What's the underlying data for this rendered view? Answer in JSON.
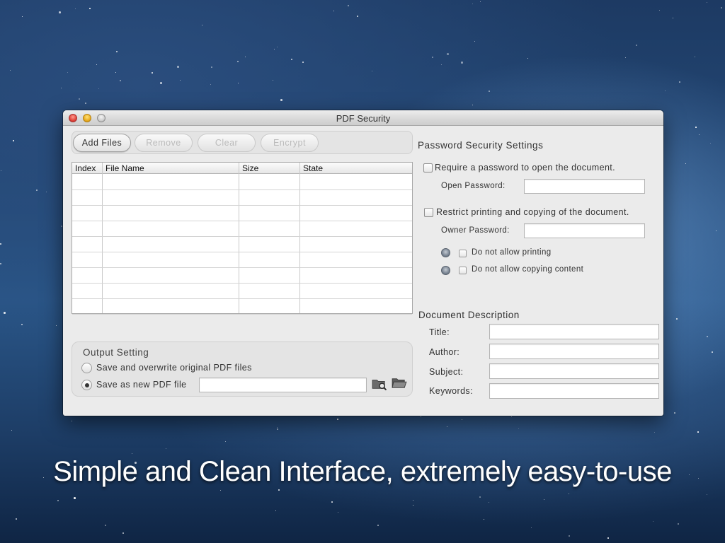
{
  "window": {
    "title": "PDF Security"
  },
  "toolbar": {
    "add_files": "Add Files",
    "remove": "Remove",
    "clear": "Clear",
    "encrypt": "Encrypt"
  },
  "table": {
    "columns": [
      "Index",
      "File Name",
      "Size",
      "State"
    ],
    "rows": []
  },
  "output": {
    "title": "Output Setting",
    "option_overwrite": "Save and overwrite original PDF files",
    "option_new": "Save as new PDF file",
    "selected": "new",
    "new_file_path": ""
  },
  "password": {
    "title": "Password Security Settings",
    "require_open": "Require a password to open the document.",
    "open_password_label": "Open Password:",
    "restrict": "Restrict printing and copying of the document.",
    "owner_password_label": "Owner Password:",
    "no_printing": "Do not allow printing",
    "no_copying": "Do not allow copying content"
  },
  "description": {
    "title": "Document Description",
    "title_label": "Title:",
    "author_label": "Author:",
    "subject_label": "Subject:",
    "keywords_label": "Keywords:"
  },
  "tagline": "Simple and Clean Interface, extremely easy-to-use",
  "icons": [
    "close-icon",
    "minimize-icon",
    "zoom-icon",
    "search-folder-icon",
    "open-folder-icon"
  ],
  "colors": {
    "window_bg": "#ebebeb",
    "accent_radio": "#7a8593"
  }
}
